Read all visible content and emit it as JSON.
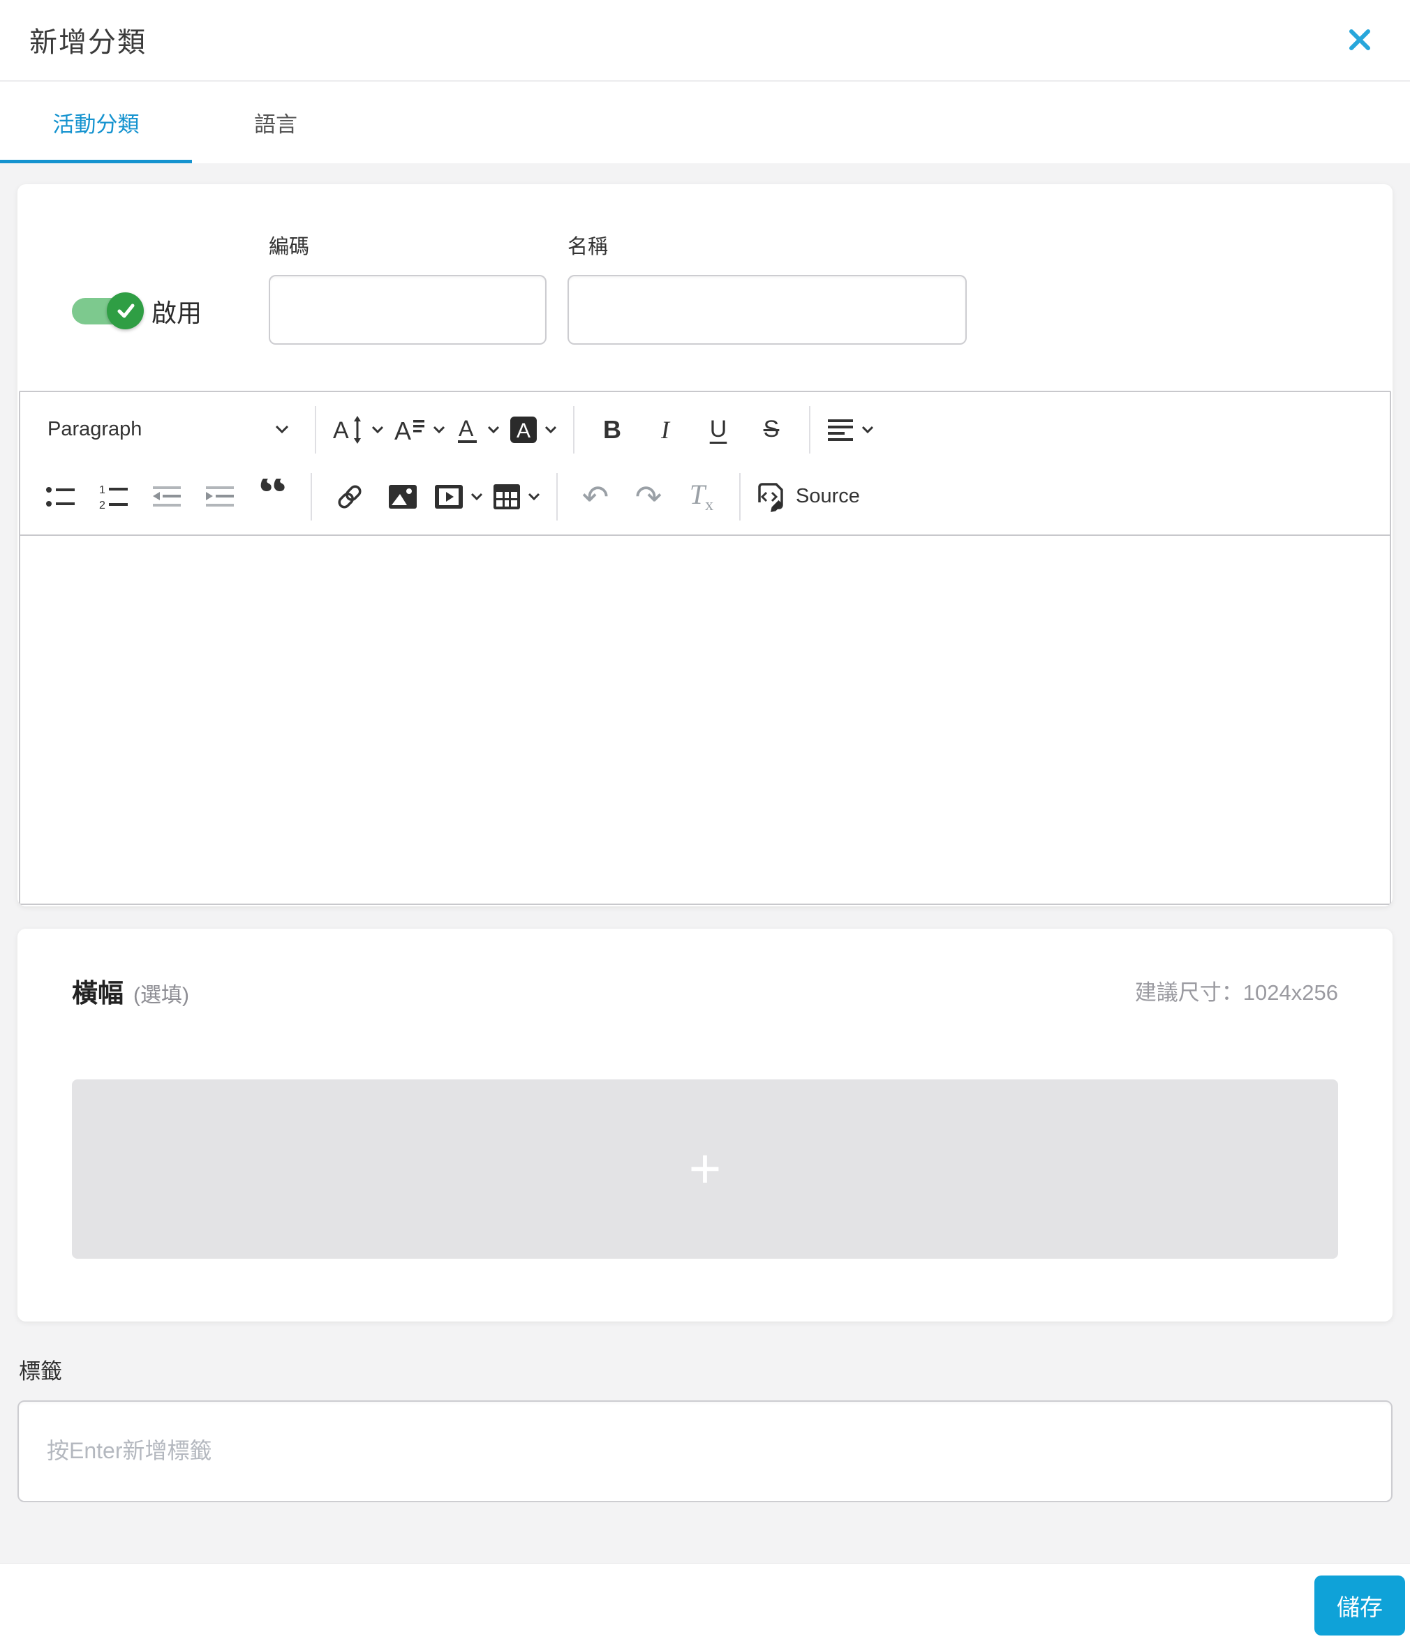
{
  "modal": {
    "title": "新增分類"
  },
  "tabs": {
    "items": [
      {
        "label": "活動分類",
        "active": true
      },
      {
        "label": "語言",
        "active": false
      }
    ]
  },
  "form": {
    "enable_label": "啟用",
    "enabled": true,
    "code": {
      "label": "編碼",
      "value": "",
      "placeholder": ""
    },
    "name": {
      "label": "名稱",
      "value": "",
      "placeholder": ""
    }
  },
  "editor": {
    "paragraph_dropdown": "Paragraph",
    "bold": "B",
    "italic": "I",
    "underline": "U",
    "strikethrough": "S",
    "quote_glyph": "“",
    "undo_glyph": "↶",
    "redo_glyph": "↷",
    "remove_format_t": "T",
    "remove_format_x": "x",
    "source_label": "Source",
    "content": ""
  },
  "banner": {
    "title": "橫幅",
    "optional_hint": "(選填)",
    "size_hint": "建議尺寸：1024x256",
    "upload_plus_glyph": "+"
  },
  "tags": {
    "label": "標籤",
    "placeholder": "按Enter新增標籤",
    "value": ""
  },
  "footer": {
    "save_label": "儲存"
  },
  "colors": {
    "tab_active_blue": "#1593cf",
    "close_blue": "#27a6db",
    "save_blue": "#0fa2d8",
    "toggle_track_green": "#7dc98e",
    "toggle_knob_green": "#2f9e44",
    "body_gray": "#f3f3f4",
    "upload_gray": "#e3e3e5"
  }
}
